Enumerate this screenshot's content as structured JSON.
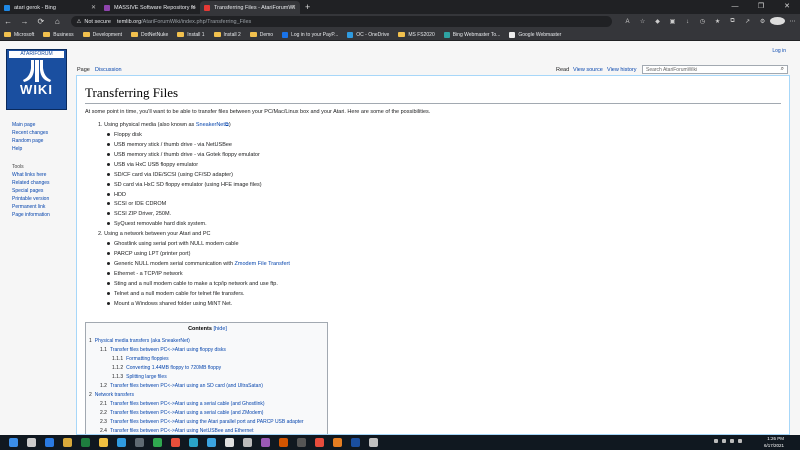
{
  "browser": {
    "tabs": [
      {
        "label": "atari gerok - Bing",
        "color": "#1e88e5"
      },
      {
        "label": "MASSIVE Software Repository fo",
        "color": "#8e44ad"
      },
      {
        "label": "Transferring Files - AtariForumWi",
        "color": "#e53935"
      }
    ],
    "new_tab": "+",
    "window_controls": [
      "—",
      "❐",
      "✕"
    ],
    "nav": {
      "back": "←",
      "forward": "→",
      "refresh": "⟳",
      "home": "⌂"
    },
    "address": {
      "warning": "⚠",
      "not_secure": "Not secure",
      "domain": "temlib.org",
      "path": "/AtariForumWiki/index.php/Transferring_Files"
    },
    "favorites": [
      {
        "label": "Microsoft",
        "icon": "folder"
      },
      {
        "label": "Business",
        "icon": "folder"
      },
      {
        "label": "Development",
        "icon": "folder"
      },
      {
        "label": "DotNetNuke",
        "icon": "folder"
      },
      {
        "label": "Install 1",
        "icon": "folder"
      },
      {
        "label": "Install 2",
        "icon": "folder"
      },
      {
        "label": "Demo",
        "icon": "folder"
      },
      {
        "label": "Log in to your PayP...",
        "icon": "paypal"
      },
      {
        "label": "OC - OneDrive",
        "icon": "cloud"
      },
      {
        "label": "MS FS2020",
        "icon": "folder"
      },
      {
        "label": "Bing Webmaster To...",
        "icon": "bing"
      },
      {
        "label": "Google Webmaster",
        "icon": "google"
      }
    ]
  },
  "wiki": {
    "logo_top": "ATARIFORUM",
    "logo_text": "WIKI",
    "login": "Log in",
    "page_tabs": {
      "page": "Page",
      "discussion": "Discussion",
      "read": "Read",
      "view_source": "View source",
      "view_history": "View history"
    },
    "search_placeholder": "Search AtariForumWiki",
    "sidebar": {
      "nav": [
        "Main page",
        "Recent changes",
        "Random page",
        "Help"
      ],
      "tools_heading": "Tools",
      "tools": [
        "What links here",
        "Related changes",
        "Special pages",
        "Printable version",
        "Permanent link",
        "Page information"
      ]
    },
    "title": "Transferring Files",
    "intro": "At some point in time, you'll want to be able to transfer files between your PC/Mac/Linux box and your Atari. Here are some of the possibilities.",
    "section1": {
      "num": "1.",
      "text": "Using physical media (also known as ",
      "link": "SneakerNet",
      "link_suffix": "⧉",
      "text_end": ")",
      "items": [
        "Floppy disk",
        "USB memory stick / thumb drive - via NetUSBee",
        "USB memory stick / thumb drive - via Gotek floppy emulator",
        "USB via HxC USB floppy emulator",
        "SD/CF card via IDE/SCSI (using CF/SD adapter)",
        "SD card via HxC SD floppy emulator (using HFE image files)",
        "HDD",
        "SCSI or IDE CDROM",
        "SCSI ZIP Driver, 250M.",
        "SyQuest removable hard disk system."
      ]
    },
    "section2": {
      "num": "2.",
      "text": "Using a network between your Atari and PC",
      "items": [
        "Ghostlink using serial port with NULL modem cable",
        "PARCP using LPT (printer port)",
        "Ethernet - a TCP/IP network",
        "Sting and a null modem cable to make a tcp/ip network and use ftp.",
        "Telnet and a null modem cable for telnet file transfers.",
        "Mount a Windows shared folder using MiNT Net."
      ],
      "generic_prefix": "Generic NULL modem serial communication with ",
      "generic_link": "Zmodem File Transfert"
    },
    "toc": {
      "title": "Contents",
      "hide": "[hide]",
      "entries": [
        {
          "n": "1",
          "t": "Physical media transfers (aka SneakerNet)",
          "level": 0
        },
        {
          "n": "1.1",
          "t": "Transfer files between PC<->Atari using floppy disks",
          "level": 1
        },
        {
          "n": "1.1.1",
          "t": "Formatting floppies",
          "level": 2
        },
        {
          "n": "1.1.2",
          "t": "Converting 1.44MB floppy to 720MB floppy",
          "level": 2
        },
        {
          "n": "1.1.3",
          "t": "Splitting large files",
          "level": 2
        },
        {
          "n": "1.2",
          "t": "Transfer files between PC<->Atari using an SD card (and UltraSatan)",
          "level": 1
        },
        {
          "n": "2",
          "t": "Network transfers",
          "level": 0
        },
        {
          "n": "2.1",
          "t": "Transfer files between PC<->Atari using a serial cable (and Ghostlink)",
          "level": 1
        },
        {
          "n": "2.2",
          "t": "Transfer files between PC<->Atari using a serial cable (and ZModem)",
          "level": 1
        },
        {
          "n": "2.3",
          "t": "Transfer files between PC<->Atari using the Atari parallel port and PARCP USB adapter",
          "level": 1
        },
        {
          "n": "2.4",
          "t": "Transfer files between PC<->Atari using NetUSBee and Ethernet",
          "level": 1
        }
      ]
    }
  },
  "taskbar": {
    "time": "1:26 PM",
    "date": "6/17/2021",
    "icons": [
      "#3b8ee8",
      "#cccccc",
      "#2a7ae2",
      "#d8a93b",
      "#1e7e3e",
      "#f0c040",
      "#2f9be0",
      "#5f6a72",
      "#2fa84f",
      "#e84f3b",
      "#2aa3c7",
      "#3ba4e0",
      "#e0e0e0",
      "#bbbbbb",
      "#9b59b6",
      "#d35400",
      "#555555",
      "#e74c3c",
      "#e67e22",
      "#1a4fa0",
      "#c0c0c0"
    ]
  }
}
